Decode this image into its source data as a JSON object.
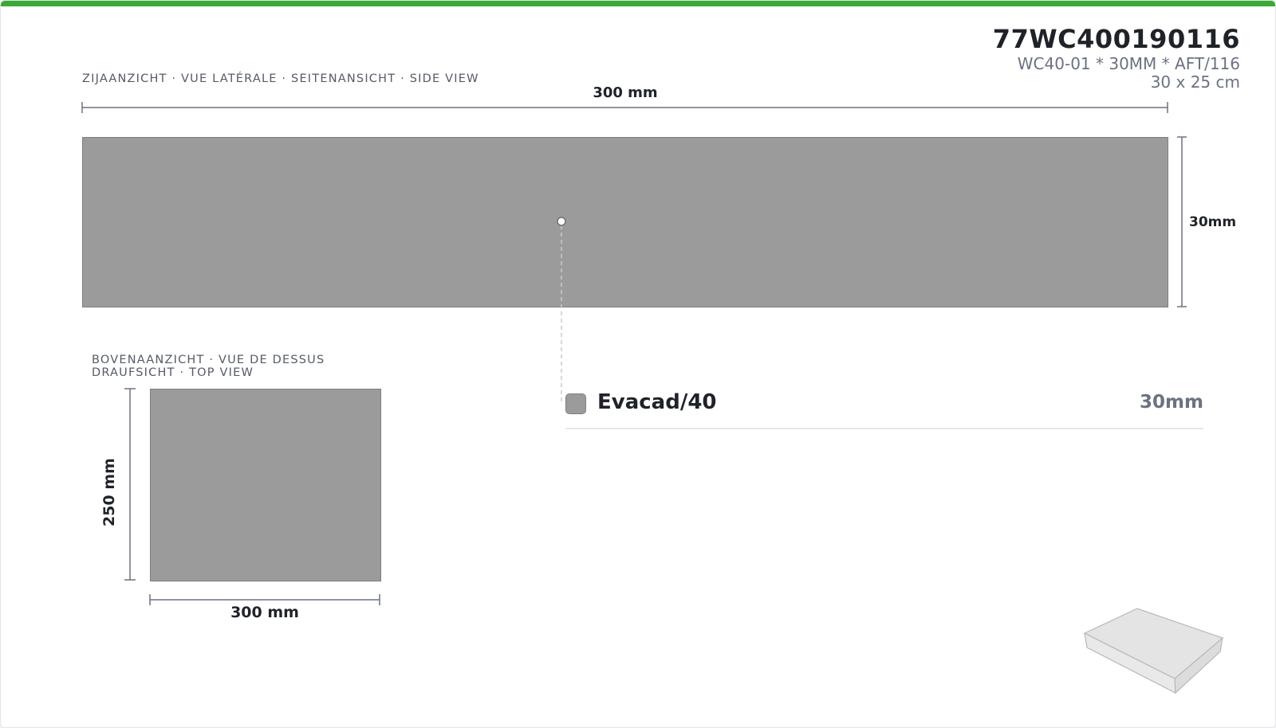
{
  "product": {
    "code": "77WC400190116",
    "description": "WC40-01 * 30MM * AFT/116",
    "size": "30 x 25 cm"
  },
  "side_view": {
    "label": "ZIJAANZICHT · VUE LATÉRALE · SEITENANSICHT · SIDE VIEW",
    "width_label": "300 mm",
    "height_label": "30mm"
  },
  "top_view": {
    "label_line1": "BOVENAANZICHT · VUE DE DESSUS",
    "label_line2": "DRAUFSICHT · TOP VIEW",
    "width_label": "300 mm",
    "depth_label": "250 mm"
  },
  "layers": [
    {
      "name": "Evacad/40",
      "thickness": "30mm",
      "color": "#9b9b9b"
    }
  ],
  "colors": {
    "accent": "#3aa935",
    "material": "#9b9b9b",
    "material_border": "#7e7e7e",
    "dimension_line": "#6b7280"
  },
  "icons": {
    "preview": "isometric-box-icon",
    "marker": "layer-marker-icon"
  }
}
